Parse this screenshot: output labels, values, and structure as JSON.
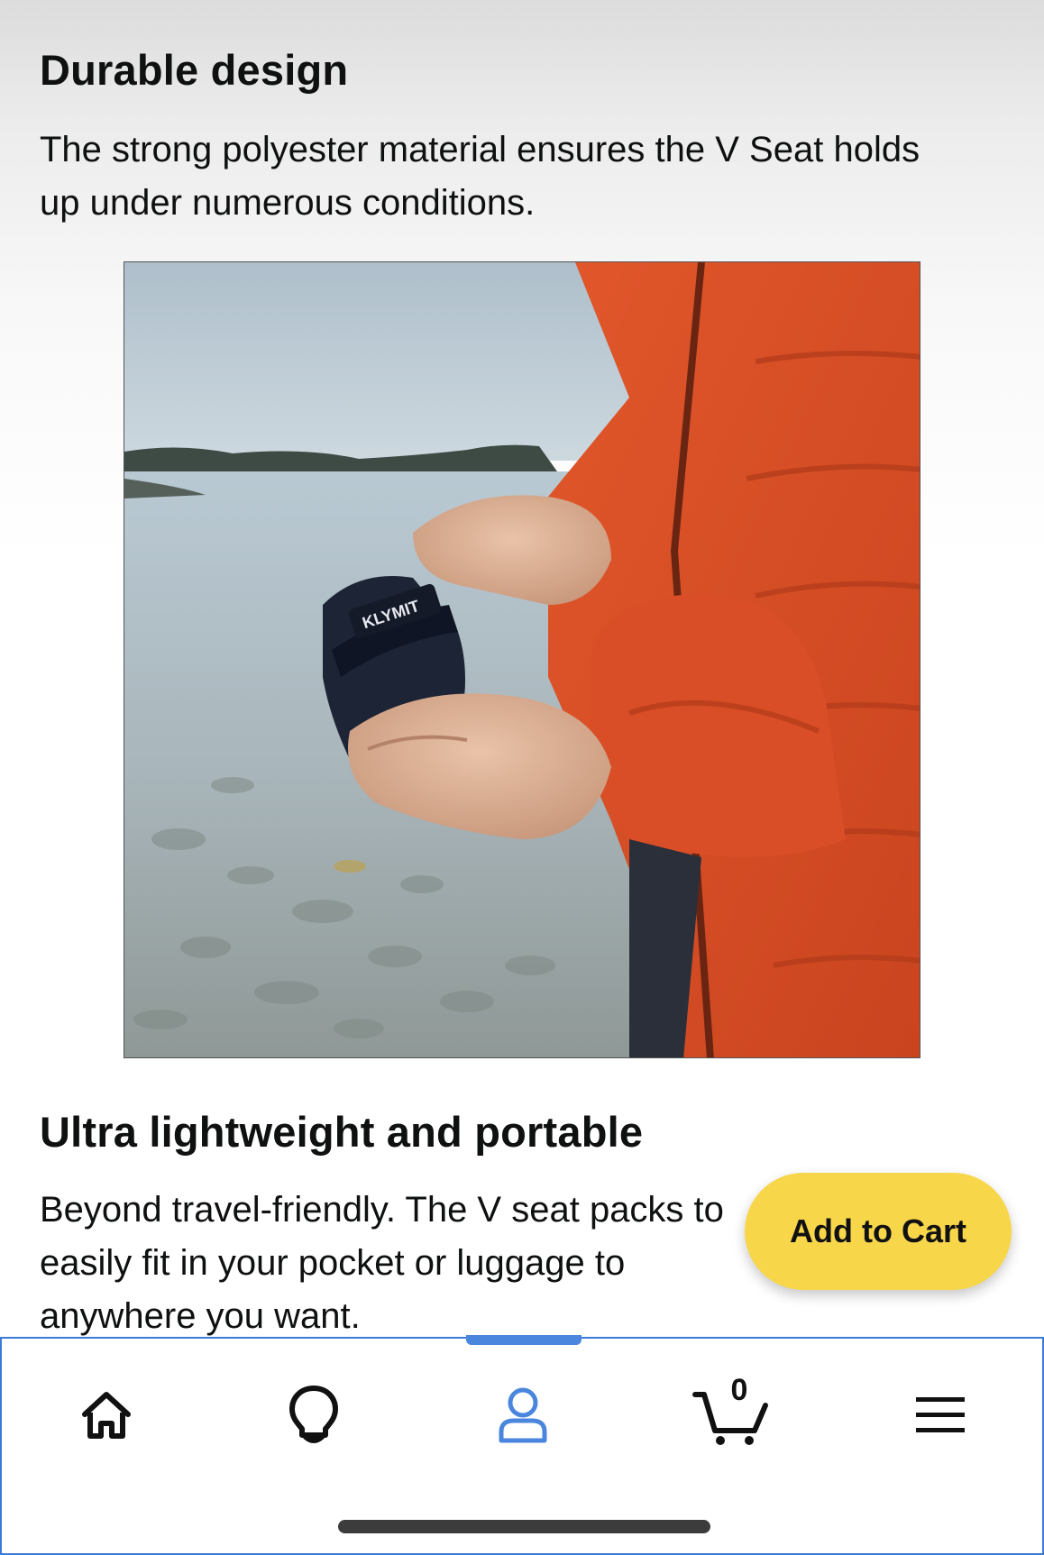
{
  "sections": [
    {
      "title": "Durable design",
      "body": "The strong polyester material ensures the V Seat holds up under numerous conditions."
    },
    {
      "title": "Ultra lightweight and portable",
      "body": "Beyond travel-friendly. The V seat packs to easily fit in your pocket or luggage to anywhere you want."
    }
  ],
  "photo": {
    "brand_label": "KLYMIT"
  },
  "add_to_cart": {
    "label": "Add to Cart",
    "color": "#f7d64a"
  },
  "nav": {
    "items": [
      {
        "name": "home",
        "icon": "home-icon"
      },
      {
        "name": "inspire",
        "icon": "lightbulb-icon"
      },
      {
        "name": "account",
        "icon": "person-icon",
        "active": true
      },
      {
        "name": "cart",
        "icon": "cart-icon"
      },
      {
        "name": "menu",
        "icon": "hamburger-menu-icon"
      }
    ],
    "cart_count": "0",
    "active_color": "#4a86de"
  }
}
